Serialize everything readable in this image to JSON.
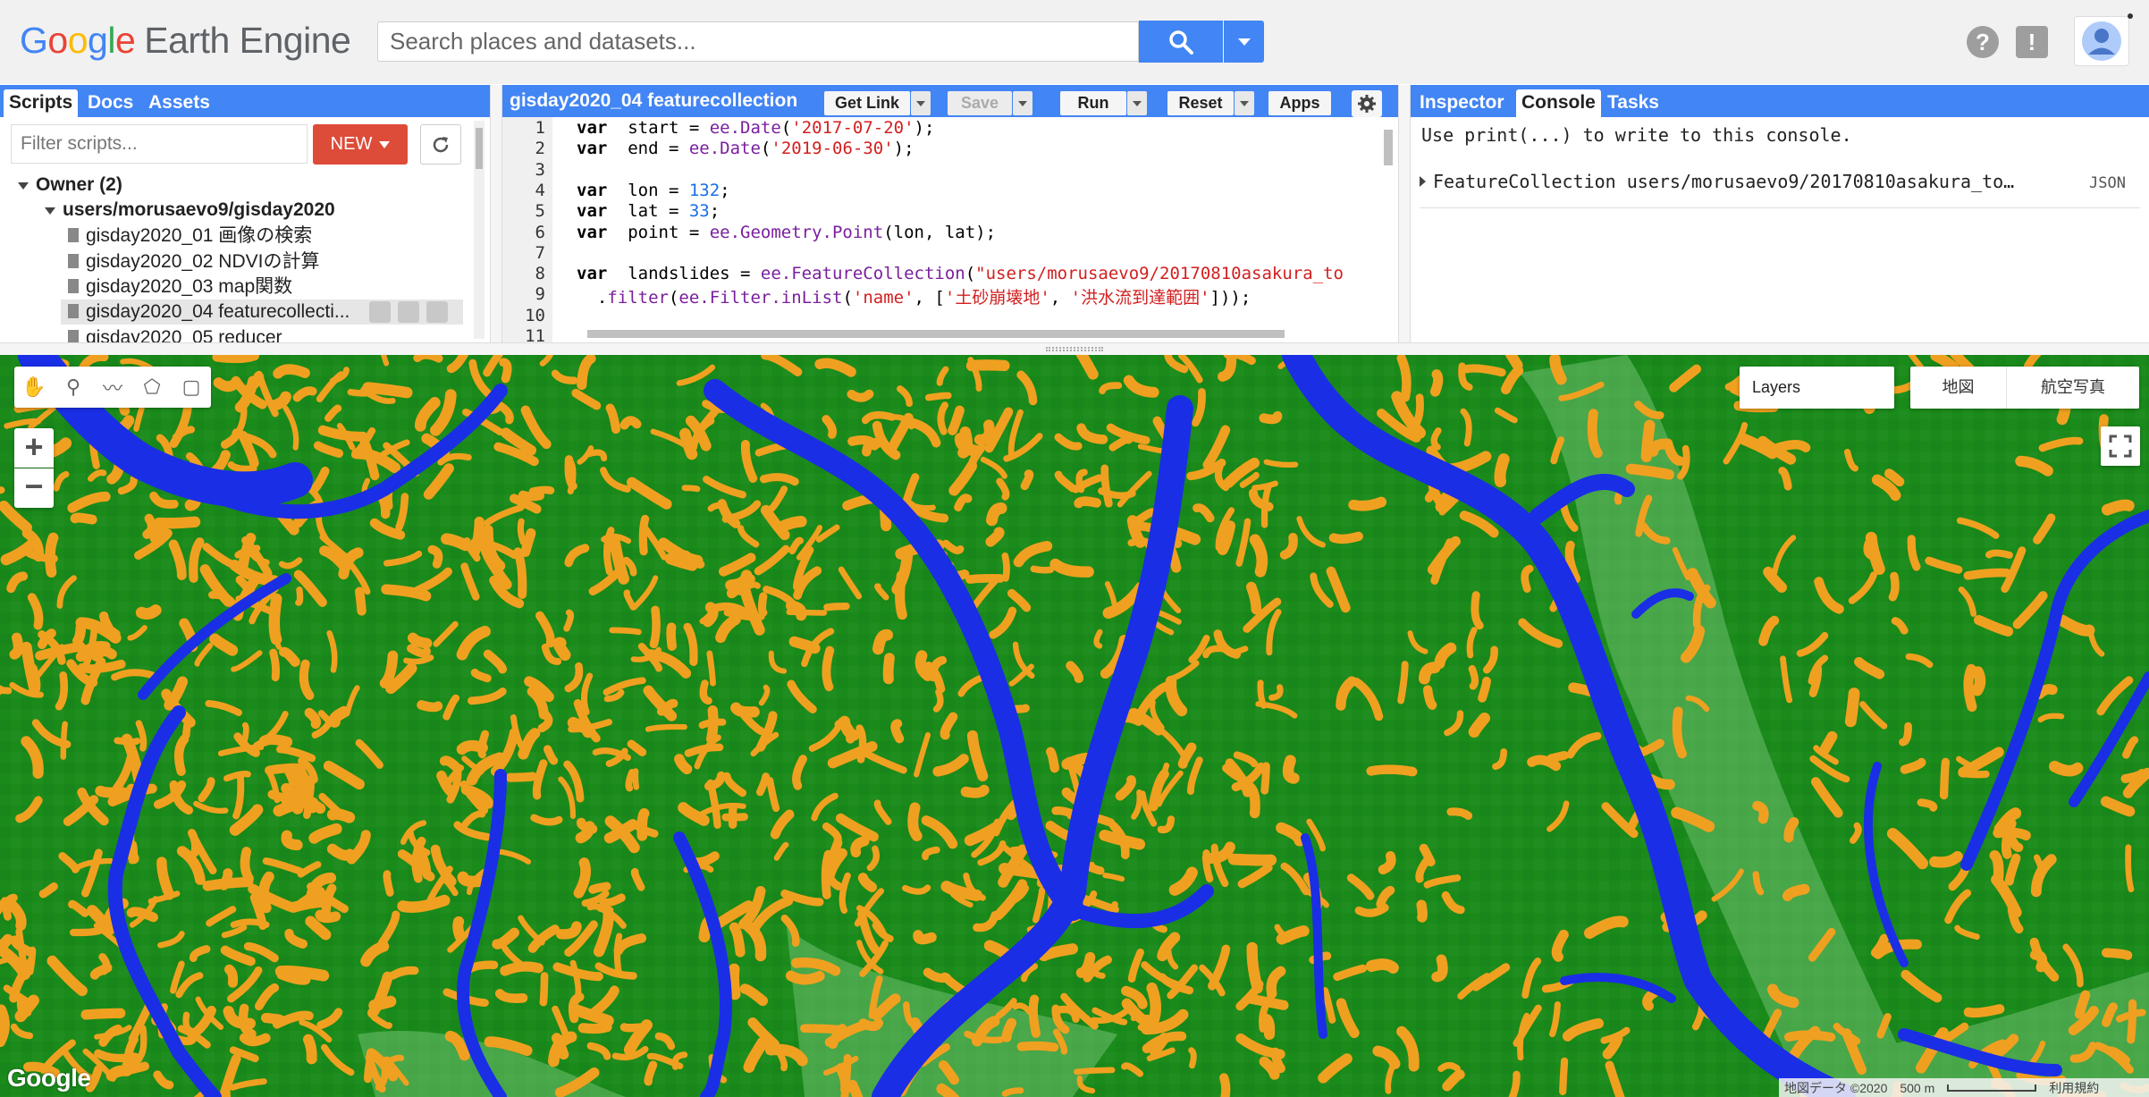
{
  "header": {
    "logo_google": [
      "G",
      "o",
      "o",
      "g",
      "l",
      "e"
    ],
    "logo_product": "Earth Engine",
    "search_placeholder": "Search places and datasets..."
  },
  "left_panel": {
    "tabs": [
      "Scripts",
      "Docs",
      "Assets"
    ],
    "active_tab": "Scripts",
    "filter_placeholder": "Filter scripts...",
    "new_label": "NEW",
    "tree": {
      "owner_label": "Owner (2)",
      "repo": "users/morusaevo9/gisday2020",
      "files": [
        "gisday2020_01 画像の検索",
        "gisday2020_02 NDVIの計算",
        "gisday2020_03 map関数",
        "gisday2020_04 featurecollecti...",
        "gisday2020_05 reducer"
      ],
      "selected_index": 3
    }
  },
  "code_panel": {
    "title": "gisday2020_04 featurecollection",
    "buttons": {
      "get_link": "Get Link",
      "save": "Save",
      "run": "Run",
      "reset": "Reset",
      "apps": "Apps"
    },
    "line_numbers": [
      "1",
      "2",
      "3",
      "4",
      "5",
      "6",
      "7",
      "8",
      "9",
      "10",
      "11"
    ],
    "lines": [
      [
        [
          "kw",
          "var"
        ],
        [
          "",
          "  start = "
        ],
        [
          "fn",
          "ee.Date"
        ],
        [
          "",
          "("
        ],
        [
          "str",
          "'2017-07-20'"
        ],
        [
          "",
          ");"
        ]
      ],
      [
        [
          "kw",
          "var"
        ],
        [
          "",
          "  end = "
        ],
        [
          "fn",
          "ee.Date"
        ],
        [
          "",
          "("
        ],
        [
          "str",
          "'2019-06-30'"
        ],
        [
          "",
          ");"
        ]
      ],
      [],
      [
        [
          "kw",
          "var"
        ],
        [
          "",
          "  lon = "
        ],
        [
          "num",
          "132"
        ],
        [
          "",
          ";"
        ]
      ],
      [
        [
          "kw",
          "var"
        ],
        [
          "",
          "  lat = "
        ],
        [
          "num",
          "33"
        ],
        [
          "",
          ";"
        ]
      ],
      [
        [
          "kw",
          "var"
        ],
        [
          "",
          "  point = "
        ],
        [
          "fn",
          "ee.Geometry.Point"
        ],
        [
          "",
          "(lon, lat);"
        ]
      ],
      [],
      [
        [
          "kw",
          "var"
        ],
        [
          "",
          "  landslides = "
        ],
        [
          "fn",
          "ee.FeatureCollection"
        ],
        [
          "",
          "("
        ],
        [
          "str",
          "\"users/morusaevo9/20170810asakura_to"
        ]
      ],
      [
        [
          "",
          "  ."
        ],
        [
          "fn",
          "filter"
        ],
        [
          "",
          "("
        ],
        [
          "fn",
          "ee.Filter.inList"
        ],
        [
          "",
          "("
        ],
        [
          "str",
          "'name'"
        ],
        [
          "",
          ", ["
        ],
        [
          "str",
          "'土砂崩壊地'"
        ],
        [
          "",
          ", "
        ],
        [
          "str",
          "'洪水流到達範囲'"
        ],
        [
          "",
          "]));"
        ]
      ],
      [],
      []
    ]
  },
  "right_panel": {
    "tabs": [
      "Inspector",
      "Console",
      "Tasks"
    ],
    "active_tab": "Console",
    "console_hint": "Use print(...) to write to this console.",
    "console_entry": "FeatureCollection users/morusaevo9/20170810asakura_to…",
    "json_label": "JSON"
  },
  "map": {
    "layers_label": "Layers",
    "map_types": [
      "地図",
      "航空写真"
    ],
    "watermark": "Google",
    "attribution": "地図データ ©2020",
    "scale": "500 m",
    "terms": "利用規約",
    "colors": {
      "vegetation": "#1a8a1a",
      "landslide": "#f0a020",
      "flood": "#1a2ee6"
    }
  }
}
